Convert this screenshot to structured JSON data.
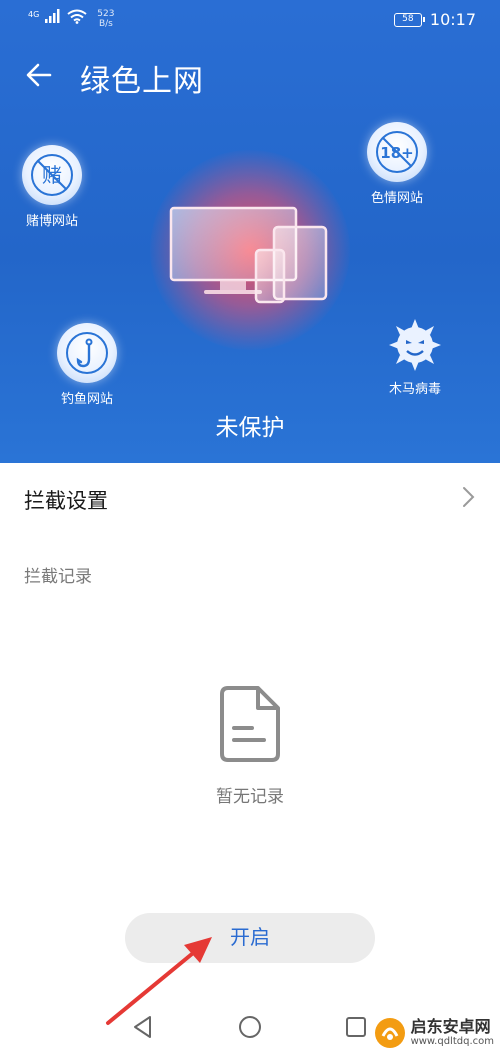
{
  "status_bar": {
    "network": "4G",
    "speed_value": "523",
    "speed_unit": "B/s",
    "battery": "58",
    "time": "10:17"
  },
  "header": {
    "title": "绿色上网",
    "back_icon": "back-arrow-icon"
  },
  "threats": [
    {
      "label": "赌博网站",
      "icon_text": "赌",
      "icon": "gambling-icon"
    },
    {
      "label": "色情网站",
      "icon_text": "18+",
      "icon": "adult-content-icon"
    },
    {
      "label": "钓鱼网站",
      "icon_text": "",
      "icon": "fishing-hook-icon"
    },
    {
      "label": "木马病毒",
      "icon_text": "",
      "icon": "virus-icon"
    }
  ],
  "protection": {
    "status": "未保护"
  },
  "settings": {
    "intercept_settings_label": "拦截设置"
  },
  "records": {
    "section_label": "拦截记录",
    "empty_text": "暂无记录"
  },
  "actions": {
    "enable_label": "开启"
  },
  "watermark": {
    "name": "启东安卓网",
    "url": "www.qdltdq.com"
  },
  "colors": {
    "hero_blue": "#2366c9",
    "accent_blue": "#2a6bd1",
    "alert_red": "#e53935"
  }
}
